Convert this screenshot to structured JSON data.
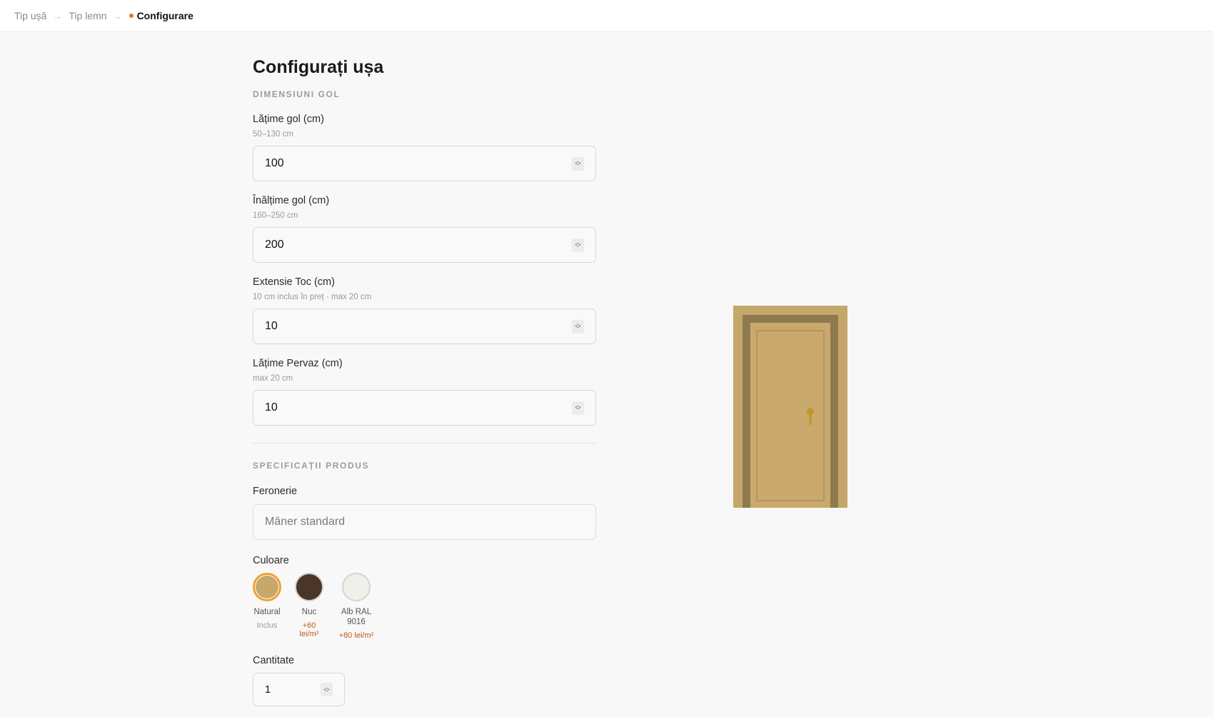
{
  "breadcrumb": {
    "step1": "Tip ușă",
    "step2": "Tip lemn",
    "step3": "Configurare",
    "separator": "→"
  },
  "page_title": "Configurați ușa",
  "dimensions": {
    "section_label": "DIMENSIUNI GOL",
    "width": {
      "label": "Lățime gol (cm)",
      "hint": "50–130 cm",
      "value": "100"
    },
    "height": {
      "label": "Înălțime gol (cm)",
      "hint": "160–250 cm",
      "value": "200"
    },
    "frame_extension": {
      "label": "Extensie Toc (cm)",
      "hint": "10 cm inclus în preț · max 20 cm",
      "value": "10"
    },
    "trim_width": {
      "label": "Lățime Pervaz (cm)",
      "hint": "max 20 cm",
      "value": "10"
    }
  },
  "specs": {
    "section_label": "SPECIFICAȚII PRODUS",
    "hardware": {
      "label": "Feronerie",
      "placeholder": "Mâner standard"
    },
    "color": {
      "label": "Culoare",
      "options": [
        {
          "name": "Natural",
          "price": "Inclus",
          "color": "#c7a86c",
          "selected": true
        },
        {
          "name": "Nuc",
          "price": "+60 lei/m²",
          "color": "#4a3526",
          "selected": false
        },
        {
          "name_line1": "Alb RAL",
          "name_line2": "9016",
          "price": "+80 lei/m²",
          "color": "#f1efea",
          "selected": false
        }
      ]
    },
    "quantity": {
      "label": "Cantitate",
      "value": "1"
    }
  },
  "colors": {
    "accent": "#e8761a",
    "price_extra": "#c0581a",
    "door_frame_outer": "#c5a76a",
    "door_frame_inner": "#8e7a4e",
    "door_leaf": "#c9a96d",
    "door_handle": "#c4952a"
  },
  "icons": {
    "number_spinner": "chevron-up-down-icon",
    "door_handle": "door-handle-icon"
  }
}
